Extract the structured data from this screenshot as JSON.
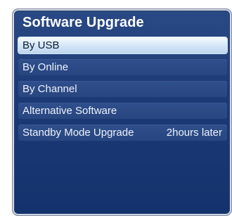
{
  "dialog": {
    "title": "Software Upgrade"
  },
  "menu": {
    "items": [
      {
        "label": "By USB",
        "selected": true
      },
      {
        "label": "By Online"
      },
      {
        "label": "By Channel"
      },
      {
        "label": "Alternative Software"
      },
      {
        "label": "Standby Mode Upgrade",
        "value": "2hours later"
      }
    ]
  }
}
